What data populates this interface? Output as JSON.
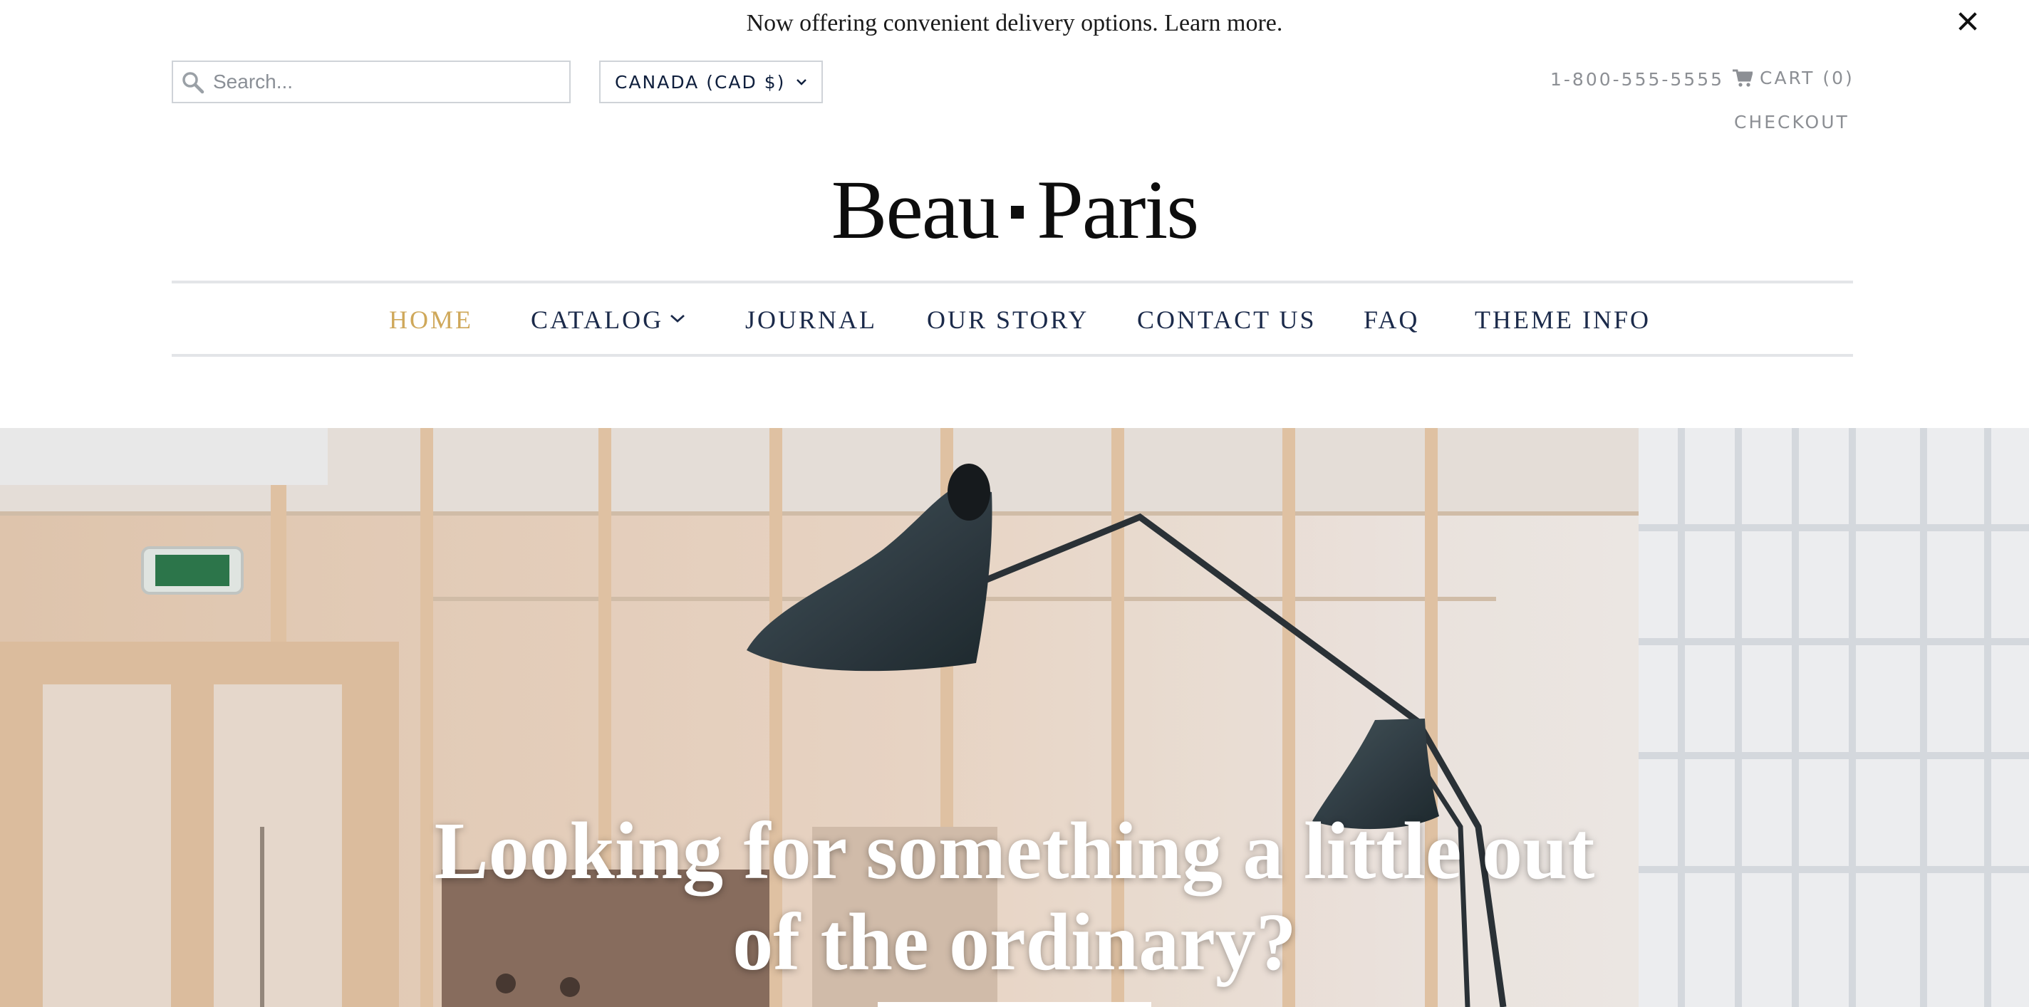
{
  "announcement": {
    "text": "Now offering convenient delivery options. Learn more.",
    "close_icon": "close-icon"
  },
  "header": {
    "search": {
      "placeholder": "Search...",
      "value": "",
      "icon": "search-icon"
    },
    "currency": {
      "selected": "CANADA (CAD $)",
      "icon": "chevron-down-icon"
    },
    "phone": "1-800-555-5555",
    "cart": {
      "label": "CART (0)",
      "icon": "cart-icon"
    },
    "checkout": "CHECKOUT"
  },
  "logo": {
    "left": "Beau",
    "right": "Paris"
  },
  "nav": {
    "items": [
      {
        "label": "HOME",
        "active": true
      },
      {
        "label": "CATALOG",
        "has_dropdown": true
      },
      {
        "label": "JOURNAL"
      },
      {
        "label": "OUR STORY"
      },
      {
        "label": "CONTACT US"
      },
      {
        "label": "FAQ"
      },
      {
        "label": "THEME INFO"
      }
    ]
  },
  "hero": {
    "heading": "Looking for something a little out of the ordinary?"
  },
  "colors": {
    "nav_active": "#cfa85a",
    "nav_text": "#1b2a4a",
    "utility_text": "#8c8f94"
  }
}
